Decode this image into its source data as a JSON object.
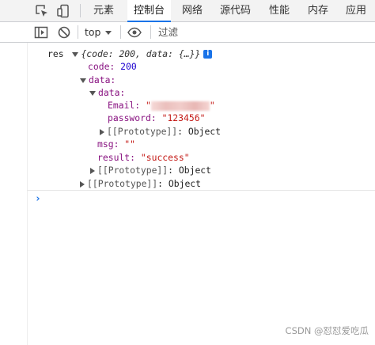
{
  "tabs": {
    "elements": "元素",
    "console": "控制台",
    "network": "网络",
    "sources": "源代码",
    "performance": "性能",
    "memory": "内存",
    "application": "应用"
  },
  "toolbar": {
    "context_label": "top",
    "filter_placeholder": "过滤"
  },
  "console": {
    "var_name": "res",
    "summary": "{code: 200, data: {…}}",
    "info_badge": "i",
    "code_key": "code:",
    "code_value": "200",
    "data_key": "data:",
    "inner_data_key": "data:",
    "email_key": "Email:",
    "email_value_open": "\"",
    "email_value_close": "\"",
    "password_key": "password:",
    "password_value": "\"123456\"",
    "proto_label": "[[Prototype]]",
    "proto_value": ": Object",
    "msg_key": "msg:",
    "msg_value": "\"\"",
    "result_key": "result:",
    "result_value": "\"success\"",
    "prompt": "›"
  },
  "watermark": "CSDN @怼怼爱吃瓜"
}
